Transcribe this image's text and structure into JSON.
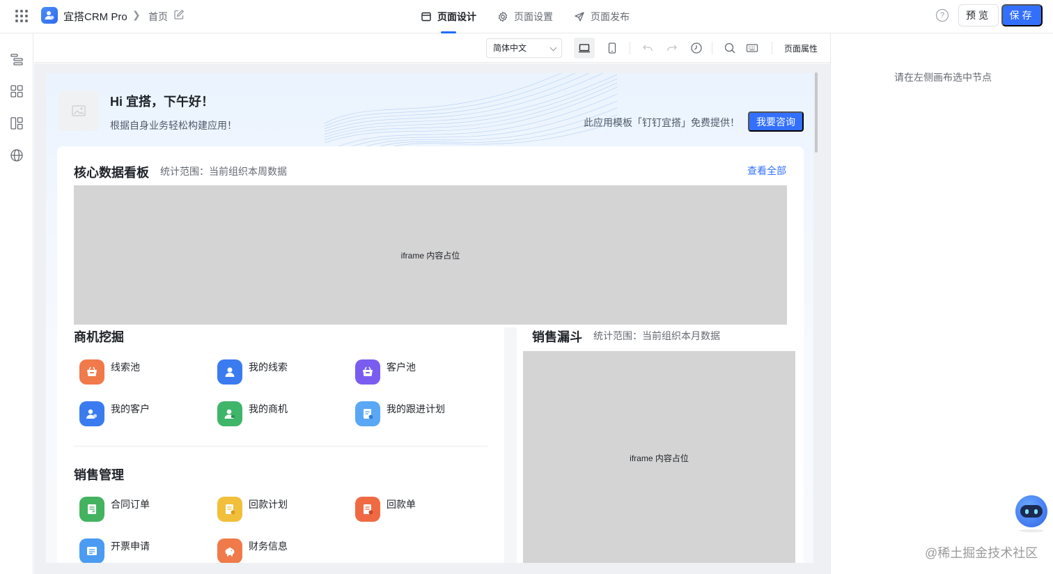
{
  "header": {
    "app_name": "宜搭CRM Pro",
    "breadcrumb_page": "首页",
    "tabs": [
      {
        "label": "页面设计",
        "active": true,
        "icon": "layout-icon"
      },
      {
        "label": "页面设置",
        "active": false,
        "icon": "gear-icon"
      },
      {
        "label": "页面发布",
        "active": false,
        "icon": "send-icon"
      }
    ],
    "help_icon": "?",
    "preview_label": "预览",
    "save_label": "保存",
    "accent_color": "#3370ff"
  },
  "rail": {
    "icons": [
      "outline-icon",
      "components-icon",
      "layout-blocks-icon",
      "globe-icon"
    ]
  },
  "toolbar": {
    "language": "简体中文",
    "page_props_label": "页面属性"
  },
  "hero": {
    "title": "Hi 宜搭，下午好！",
    "subtitle": "根据自身业务轻松构建应用！",
    "note": "此应用模板「钉钉宜搭」免费提供！",
    "consult_label": "我要咨询"
  },
  "dashboard": {
    "title": "核心数据看板",
    "scope": "统计范围：当前组织本周数据",
    "view_all": "查看全部",
    "iframe_label": "iframe 内容占位"
  },
  "opportunity": {
    "title": "商机挖掘",
    "items": [
      {
        "label": "线索池",
        "color": "#f07a4a"
      },
      {
        "label": "我的线索",
        "color": "#3a7bf0"
      },
      {
        "label": "客户池",
        "color": "#7b5cf0"
      },
      {
        "label": "我的客户",
        "color": "#3a7bf0"
      },
      {
        "label": "我的商机",
        "color": "#3fb56a"
      },
      {
        "label": "我的跟进计划",
        "color": "#5aa8f5"
      }
    ]
  },
  "sales": {
    "title": "销售管理",
    "items": [
      {
        "label": "合同订单",
        "color": "#43b35f"
      },
      {
        "label": "回款计划",
        "color": "#f2bf3b"
      },
      {
        "label": "回款单",
        "color": "#ef6a43"
      },
      {
        "label": "开票申请",
        "color": "#4b9bf2"
      },
      {
        "label": "财务信息",
        "color": "#f07a4a"
      }
    ]
  },
  "funnel": {
    "title": "销售漏斗",
    "scope": "统计范围：当前组织本月数据",
    "iframe_label": "iframe 内容占位"
  },
  "props_panel": {
    "empty_text": "请在左侧画布选中节点"
  },
  "watermark": "@稀土掘金技术社区"
}
